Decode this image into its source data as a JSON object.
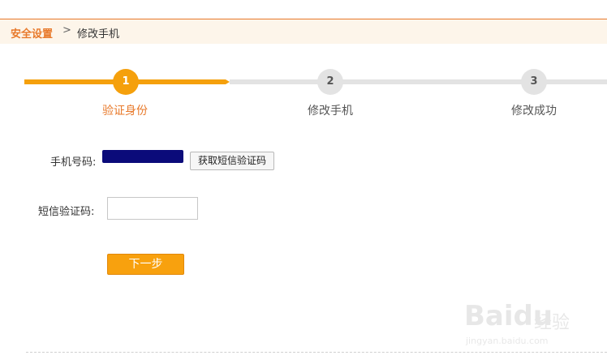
{
  "breadcrumb": {
    "main": "安全设置",
    "separator": ">",
    "current": "修改手机"
  },
  "steps": [
    {
      "number": "1",
      "label": "验证身份",
      "active": true
    },
    {
      "number": "2",
      "label": "修改手机",
      "active": false
    },
    {
      "number": "3",
      "label": "修改成功",
      "active": false
    }
  ],
  "form": {
    "phone_label": "手机号码:",
    "sms_button": "获取短信验证码",
    "code_label": "短信验证码:",
    "code_value": "",
    "next_button": "下一步"
  },
  "watermark": {
    "brand": "Baidu",
    "cn": "经验",
    "url": "jingyan.baidu.com"
  },
  "colors": {
    "accent": "#f5a00c",
    "accent_text": "#e8792a",
    "track_idle": "#e3e3e3",
    "masked_phone": "#0b0b7a"
  }
}
